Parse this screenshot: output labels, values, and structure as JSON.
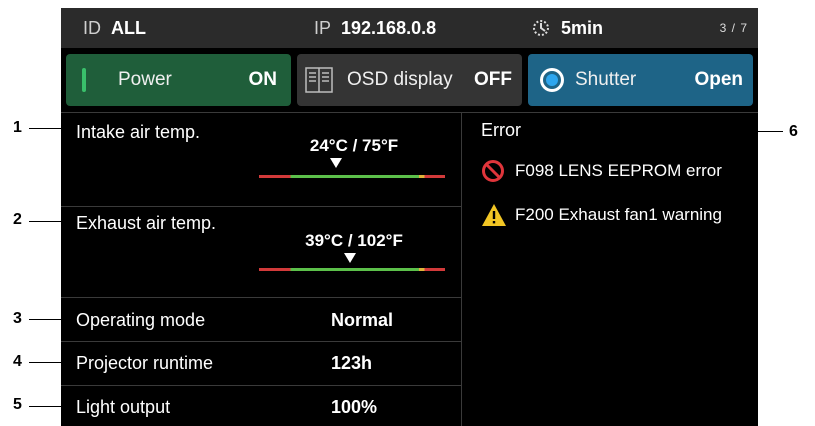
{
  "status_bar": {
    "id_label": "ID",
    "id_value": "ALL",
    "ip_label": "IP",
    "ip_value": "192.168.0.8",
    "timer_icon": "timer-icon",
    "timer_value": "5min",
    "page": "3 / 7"
  },
  "toggles": {
    "power": {
      "label": "Power",
      "value": "ON",
      "color": "#1f5e3a"
    },
    "osd": {
      "label": "OSD display",
      "value": "OFF",
      "icon": "osd-icon"
    },
    "shutter": {
      "label": "Shutter",
      "value": "Open",
      "color": "#1e6487"
    }
  },
  "rows": {
    "intake": {
      "label": "Intake air temp.",
      "value": "24°C / 75°F"
    },
    "exhaust": {
      "label": "Exhaust air temp.",
      "value": "39°C / 102°F"
    },
    "mode": {
      "label": "Operating mode",
      "value": "Normal"
    },
    "runtime": {
      "label": "Projector runtime",
      "value": "123h"
    },
    "light": {
      "label": "Light output",
      "value": "100%"
    }
  },
  "error": {
    "title": "Error",
    "items": [
      {
        "icon": "prohibited-icon",
        "text": "F098 LENS EEPROM error"
      },
      {
        "icon": "warning-icon",
        "text": "F200 Exhaust fan1 warning"
      }
    ]
  },
  "callouts": [
    "1",
    "2",
    "3",
    "4",
    "5",
    "6"
  ]
}
